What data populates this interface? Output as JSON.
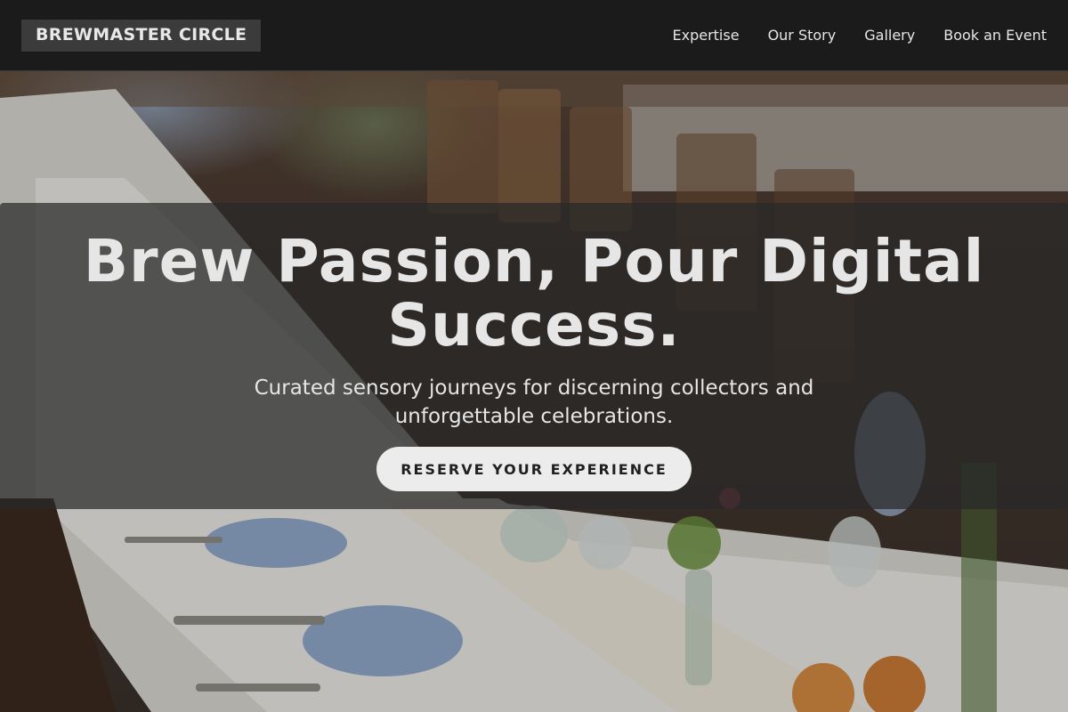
{
  "navbar": {
    "brand": "BREWMASTER CIRCLE",
    "links": [
      "Expertise",
      "Our Story",
      "Gallery",
      "Book an Event"
    ]
  },
  "hero": {
    "title": "Brew Passion, Pour Digital Success.",
    "subtitle": "Curated sensory journeys for discerning collectors and unforgettable celebrations.",
    "cta_label": "RESERVE YOUR EXPERIENCE"
  },
  "colors": {
    "navbar_bg": "#1b1b1b",
    "brand_bg": "#3b3b3b",
    "cta_bg": "#ececec",
    "overlay": "rgba(40,40,40,0.72)"
  }
}
